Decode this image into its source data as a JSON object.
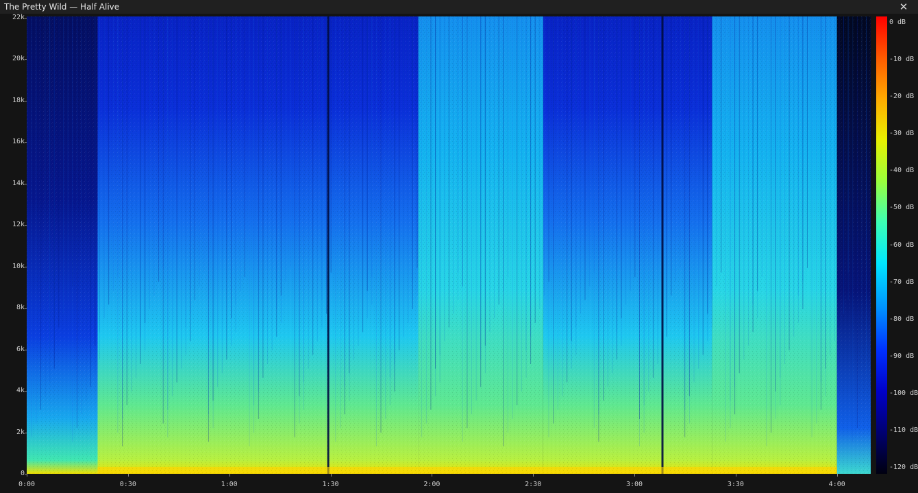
{
  "window": {
    "title": "The Pretty Wild — Half Alive",
    "close_glyph": "✕",
    "close_icon": "close-icon"
  },
  "chart_data": {
    "type": "heatmap",
    "title": "",
    "xlabel": "",
    "ylabel": "",
    "x_axis": {
      "unit": "time (m:ss)",
      "range": [
        "0:00",
        "4:10"
      ],
      "ticks": [
        "0:00",
        "0:30",
        "1:00",
        "1:30",
        "2:00",
        "2:30",
        "3:00",
        "3:30",
        "4:00"
      ]
    },
    "y_axis": {
      "unit": "frequency (Hz)",
      "range": [
        0,
        22050
      ],
      "ticks": [
        "0",
        "2k",
        "4k",
        "6k",
        "8k",
        "10k",
        "12k",
        "14k",
        "16k",
        "18k",
        "20k",
        "22k"
      ]
    },
    "colorbar": {
      "range_db": [
        -120,
        0
      ],
      "ticks": [
        "0 dB",
        "-10 dB",
        "-20 dB",
        "-30 dB",
        "-40 dB",
        "-50 dB",
        "-60 dB",
        "-70 dB",
        "-80 dB",
        "-90 dB",
        "-100 dB",
        "-110 dB",
        "-120 dB"
      ],
      "colormap": "jet"
    },
    "segments_seconds": [
      {
        "start": 0,
        "end": 21,
        "level": "quiet"
      },
      {
        "start": 21,
        "end": 116,
        "level": "loud-dark-highs"
      },
      {
        "start": 116,
        "end": 153,
        "level": "loud"
      },
      {
        "start": 153,
        "end": 203,
        "level": "loud-dark-highs"
      },
      {
        "start": 203,
        "end": 240,
        "level": "loud"
      },
      {
        "start": 240,
        "end": 250,
        "level": "fade"
      }
    ]
  }
}
